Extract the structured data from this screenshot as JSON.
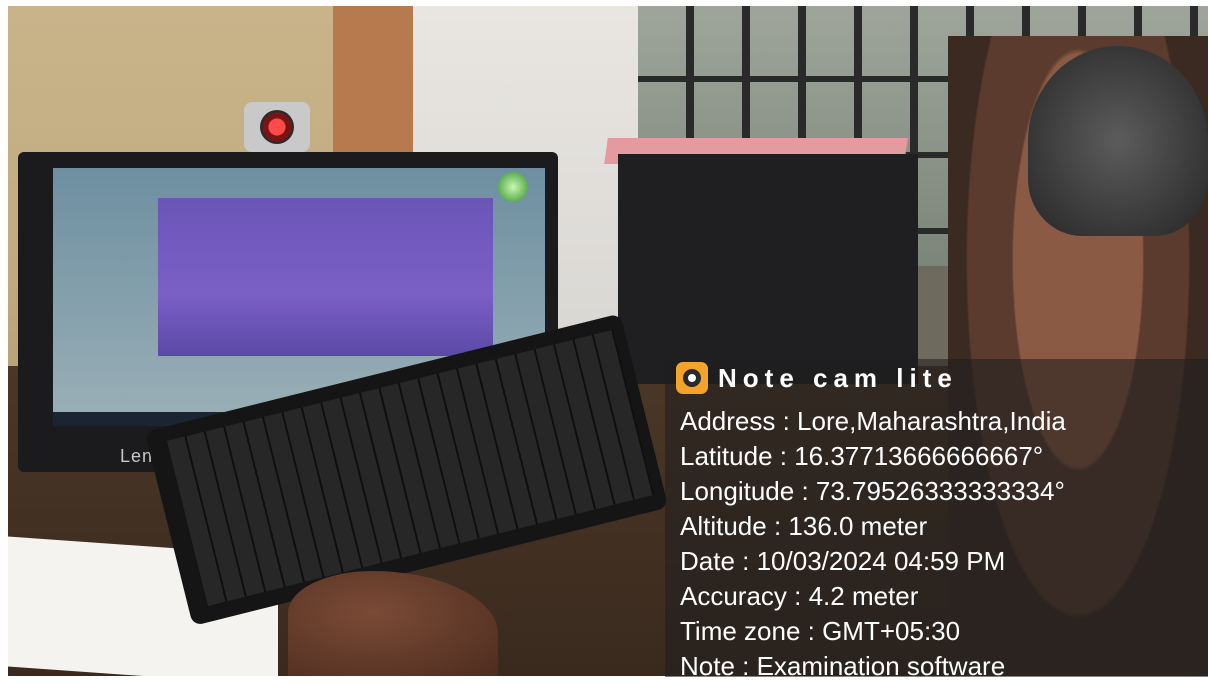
{
  "photo": {
    "monitor_brand": "Lenovo"
  },
  "overlay": {
    "app_name": "Note cam lite",
    "app_icon": "camera-icon",
    "address": "Address : Lore,Maharashtra,India",
    "latitude": "Latitude : 16.37713666666667°",
    "longitude": "Longitude : 73.79526333333334°",
    "altitude": "Altitude : 136.0 meter",
    "date": "Date : 10/03/2024 04:59 PM",
    "accuracy": "Accuracy : 4.2 meter",
    "timezone": "Time zone : GMT+05:30",
    "note": "Note : Examination software"
  }
}
